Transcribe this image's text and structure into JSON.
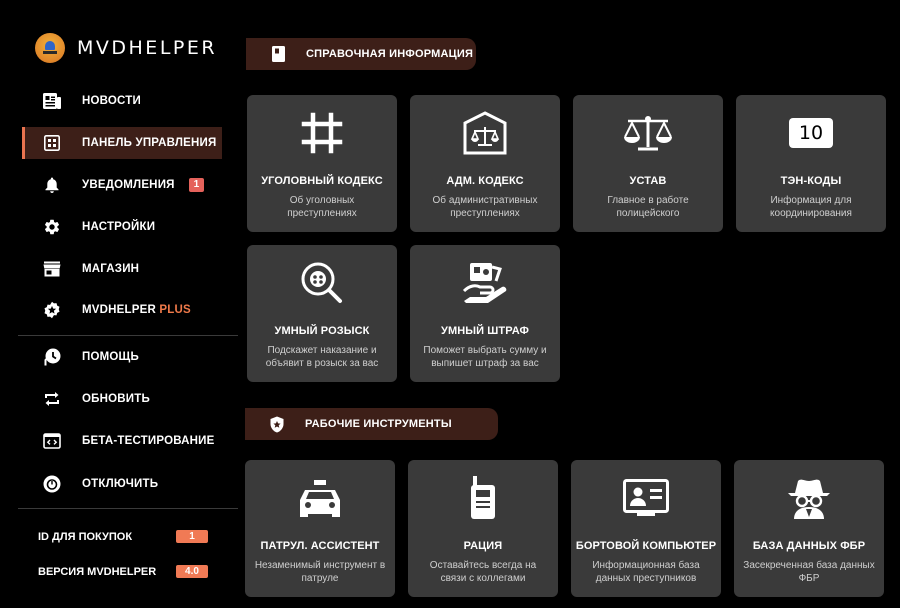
{
  "brand": {
    "name": "MVDHELPER"
  },
  "sidebar": {
    "items": [
      {
        "label": "НОВОСТИ",
        "icon": "news-icon"
      },
      {
        "label": "ПАНЕЛЬ УПРАВЛЕНИЯ",
        "icon": "dashboard-icon",
        "active": true
      },
      {
        "label": "УВЕДОМЛЕНИЯ",
        "icon": "bell-icon",
        "badge": "1"
      },
      {
        "label": "НАСТРОЙКИ",
        "icon": "gear-icon"
      },
      {
        "label": "МАГАЗИН",
        "icon": "store-icon"
      },
      {
        "label": "MVDHELPER",
        "label_suffix": "PLUS",
        "icon": "star-badge-icon"
      }
    ],
    "items2": [
      {
        "label": "ПОМОЩЬ",
        "icon": "help-icon"
      },
      {
        "label": "ОБНОВИТЬ",
        "icon": "refresh-icon"
      },
      {
        "label": "БЕТА-ТЕСТИРОВАНИЕ",
        "icon": "code-icon"
      },
      {
        "label": "ОТКЛЮЧИТЬ",
        "icon": "power-icon"
      }
    ],
    "info": [
      {
        "label": "ID ДЛЯ ПОКУПОК",
        "value": "1"
      },
      {
        "label": "ВЕРСИЯ MVDHELPER",
        "value": "4.0"
      }
    ]
  },
  "sections": [
    {
      "title": "СПРАВОЧНАЯ ИНФОРМАЦИЯ",
      "icon": "book-icon",
      "cards": [
        {
          "title": "УГОЛОВНЫЙ КОДЕКС",
          "desc": "Об уголовных преступлениях",
          "icon": "hash-icon"
        },
        {
          "title": "АДМ. КОДЕКС",
          "desc": "Об административных преступлениях",
          "icon": "scales-frame-icon"
        },
        {
          "title": "УСТАВ",
          "desc": "Главное в работе полицейского",
          "icon": "scales-icon"
        },
        {
          "title": "ТЭН-КОДЫ",
          "desc": "Информация для координирования",
          "icon": "ten-code-icon",
          "icon_text": "10"
        },
        {
          "title": "УМНЫЙ РОЗЫСК",
          "desc": "Подскажет наказание и объявит в розыск за вас",
          "icon": "search-icon"
        },
        {
          "title": "УМНЫЙ ШТРАФ",
          "desc": "Поможет выбрать сумму и выпишет штраф за вас",
          "icon": "payment-icon"
        }
      ]
    },
    {
      "title": "РАБОЧИЕ ИНСТРУМЕНТЫ",
      "icon": "police-badge-icon",
      "cards": [
        {
          "title": "ПАТРУЛ. АССИСТЕНТ",
          "desc": "Незаменимый инструмент в патруле",
          "icon": "police-car-icon"
        },
        {
          "title": "РАЦИЯ",
          "desc": "Оставайтесь всегда на связи с коллегами",
          "icon": "radio-icon"
        },
        {
          "title": "БОРТОВОЙ КОМПЬЮТЕР",
          "desc": "Информационная база данных преступников",
          "icon": "id-card-icon"
        },
        {
          "title": "БАЗА ДАННЫХ ФБР",
          "desc": "Засекреченная база данных ФБР",
          "icon": "spy-icon"
        }
      ]
    }
  ]
}
